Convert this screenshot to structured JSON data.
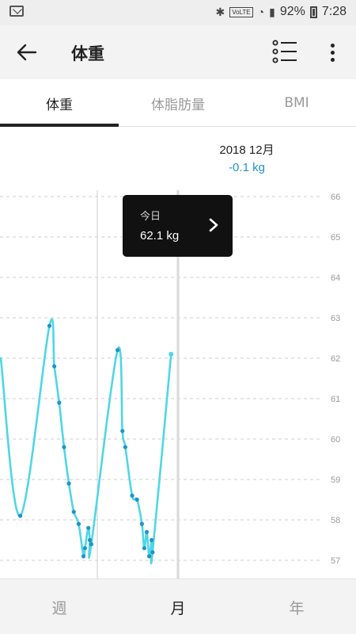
{
  "status_bar": {
    "mail_icon": "mail-icon",
    "bluetooth_icon": "bluetooth-icon",
    "volte": "VoLTE",
    "battery_percent": "92%",
    "time": "7:28"
  },
  "app_bar": {
    "title": "体重",
    "back_icon": "arrow-left-icon",
    "list_icon": "list-icon",
    "more_icon": "more-vertical-icon"
  },
  "tabs": [
    {
      "label": "体重",
      "active": true
    },
    {
      "label": "体脂肪量",
      "active": false
    },
    {
      "label": "BMI",
      "active": false
    }
  ],
  "chart_header": {
    "period": "2018 12月",
    "delta": "-0.1 kg"
  },
  "tooltip": {
    "label": "今日",
    "value": "62.1 kg"
  },
  "bottom_nav": [
    {
      "label": "週",
      "active": false
    },
    {
      "label": "月",
      "active": true
    },
    {
      "label": "年",
      "active": false
    }
  ],
  "colors": {
    "line": "#4fd6e6",
    "point": "#1e93c9",
    "delta": "#1e93c9",
    "tooltip_bg": "#111111"
  },
  "chart_data": {
    "type": "line",
    "unit": "kg",
    "ylim": [
      57,
      66
    ],
    "yticks": [
      "66",
      "65",
      "64",
      "63",
      "62",
      "61",
      "60",
      "59",
      "58",
      "57"
    ],
    "grid": true,
    "yaxis_position": "right",
    "series": [
      {
        "points": [
          {
            "x": 1,
            "y": 62.0
          },
          {
            "x": 5,
            "y": 58.1
          },
          {
            "x": 11,
            "y": 62.8
          },
          {
            "x": 12,
            "y": 61.8
          },
          {
            "x": 13,
            "y": 60.9
          },
          {
            "x": 14,
            "y": 59.8
          },
          {
            "x": 15,
            "y": 58.9
          },
          {
            "x": 16,
            "y": 58.2
          },
          {
            "x": 17,
            "y": 57.9
          },
          {
            "x": 18,
            "y": 57.1
          },
          {
            "x": 18.3,
            "y": 57.3
          },
          {
            "x": 19,
            "y": 57.8
          },
          {
            "x": 19.3,
            "y": 57.5
          },
          {
            "x": 19.6,
            "y": 57.4
          },
          {
            "x": 25,
            "y": 62.2
          },
          {
            "x": 26,
            "y": 60.2
          },
          {
            "x": 26.6,
            "y": 59.8
          },
          {
            "x": 28,
            "y": 58.6
          },
          {
            "x": 29,
            "y": 58.5
          },
          {
            "x": 30,
            "y": 57.9
          },
          {
            "x": 30.5,
            "y": 57.3
          },
          {
            "x": 31,
            "y": 57.7
          },
          {
            "x": 31.5,
            "y": 57.1
          },
          {
            "x": 32,
            "y": 57.5
          },
          {
            "x": 32.2,
            "y": 57.2
          },
          {
            "x": 36,
            "y": 62.1
          }
        ]
      }
    ]
  }
}
